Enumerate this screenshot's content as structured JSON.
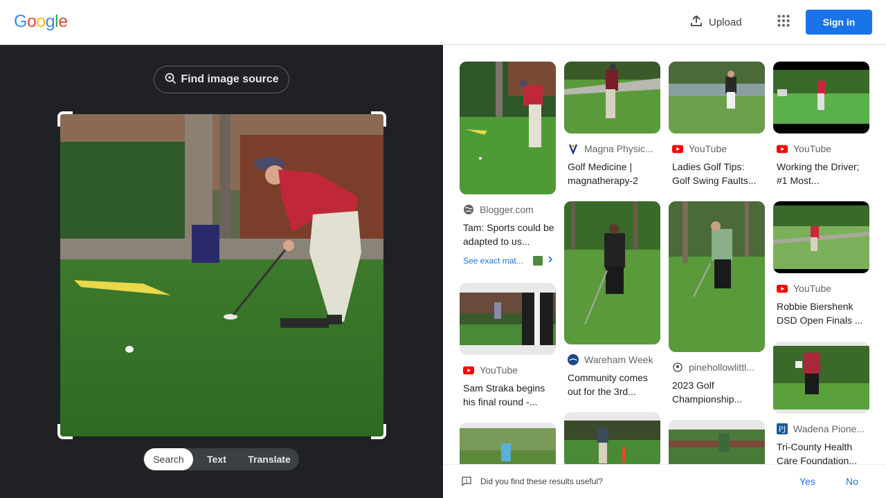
{
  "header": {
    "logo_letters": [
      {
        "ch": "G",
        "color": "#4285f4"
      },
      {
        "ch": "o",
        "color": "#ea4335"
      },
      {
        "ch": "o",
        "color": "#fbbc05"
      },
      {
        "ch": "g",
        "color": "#4285f4"
      },
      {
        "ch": "l",
        "color": "#34a853"
      },
      {
        "ch": "e",
        "color": "#ea4335"
      }
    ],
    "upload_label": "Upload",
    "signin_label": "Sign in"
  },
  "left_panel": {
    "find_source_label": "Find image source",
    "modes": [
      "Search",
      "Text",
      "Translate"
    ],
    "active_mode": "Search"
  },
  "results": [
    {
      "source": "Blogger.com",
      "favicon": "globe-icon",
      "title": "Tam: Sports could be adapted to us...",
      "exact": "See exact mat..."
    },
    {
      "source": "Magna Physic...",
      "favicon": "magna-logo-icon",
      "title": "Golf Medicine | magnatherapy-2"
    },
    {
      "source": "YouTube",
      "favicon": "youtube-icon",
      "title": "Ladies Golf Tips: Golf Swing Faults..."
    },
    {
      "source": "YouTube",
      "favicon": "youtube-icon",
      "title": "Working the Driver; #1 Most..."
    },
    {
      "source": "YouTube",
      "favicon": "youtube-icon",
      "title": "Sam Straka begins his final round -..."
    },
    {
      "source": "Wareham Week",
      "favicon": "wareham-logo-icon",
      "title": "Community comes out for the 3rd..."
    },
    {
      "source": "pinehollowlittl...",
      "favicon": "pinehollow-logo-icon",
      "title": "2023 Golf Championship..."
    },
    {
      "source": "YouTube",
      "favicon": "youtube-icon",
      "title": "Robbie Biershenk DSD Open Finals ..."
    },
    {
      "source": "Wadena Pione...",
      "favicon": "wadena-logo-icon",
      "title": "Tri-County Health Care Foundation..."
    }
  ],
  "feedback": {
    "question": "Did you find these results useful?",
    "yes": "Yes",
    "no": "No"
  },
  "colors": {
    "accent": "#1a73e8",
    "dark_panel": "#202124",
    "youtube_red": "#ff0000"
  }
}
